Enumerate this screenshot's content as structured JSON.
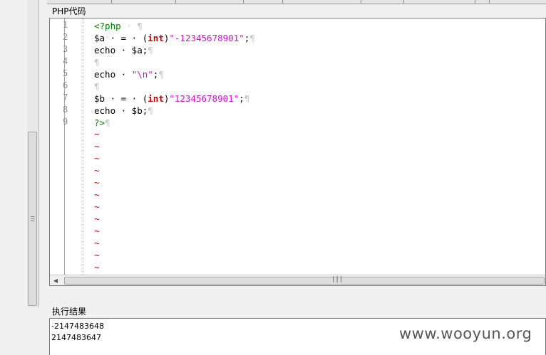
{
  "code_panel": {
    "title": "PHP代码",
    "lines": [
      {
        "no": "1",
        "parts": [
          {
            "t": "<?php",
            "c": "tag"
          },
          {
            "t": " · ",
            "c": "dot"
          },
          {
            "t": "¶",
            "c": "pil"
          }
        ]
      },
      {
        "no": "2",
        "parts": [
          {
            "t": "$a · = · (",
            "c": ""
          },
          {
            "t": "int",
            "c": "kw"
          },
          {
            "t": ")",
            "c": ""
          },
          {
            "t": "\"-12345678901\"",
            "c": "str"
          },
          {
            "t": ";",
            "c": ""
          },
          {
            "t": "¶",
            "c": "pil"
          }
        ]
      },
      {
        "no": "3",
        "parts": [
          {
            "t": "echo · $a;",
            "c": ""
          },
          {
            "t": "¶",
            "c": "pil"
          }
        ]
      },
      {
        "no": "4",
        "parts": [
          {
            "t": "¶",
            "c": "pil"
          }
        ]
      },
      {
        "no": "5",
        "parts": [
          {
            "t": "echo · ",
            "c": ""
          },
          {
            "t": "\"\\n\"",
            "c": "str"
          },
          {
            "t": ";",
            "c": ""
          },
          {
            "t": "¶",
            "c": "pil"
          }
        ]
      },
      {
        "no": "6",
        "parts": [
          {
            "t": "¶",
            "c": "pil"
          }
        ]
      },
      {
        "no": "7",
        "parts": [
          {
            "t": "$b · = · (",
            "c": ""
          },
          {
            "t": "int",
            "c": "kw"
          },
          {
            "t": ")",
            "c": ""
          },
          {
            "t": "\"12345678901\"",
            "c": "str"
          },
          {
            "t": ";",
            "c": ""
          },
          {
            "t": "¶",
            "c": "pil"
          }
        ]
      },
      {
        "no": "8",
        "parts": [
          {
            "t": "echo · $b;",
            "c": ""
          },
          {
            "t": "¶",
            "c": "pil"
          }
        ]
      },
      {
        "no": "9",
        "parts": [
          {
            "t": "?>",
            "c": "tag"
          },
          {
            "t": "¶",
            "c": "pil"
          }
        ]
      }
    ],
    "empty_marker": "~",
    "empty_count": 12
  },
  "result_panel": {
    "title": "执行结果",
    "lines": [
      "-2147483648",
      "2147483647"
    ]
  },
  "watermark": "www.wooyun.org",
  "icons": {
    "scroll_left": "arrow-left-icon",
    "grip": "grip-icon"
  },
  "colors": {
    "keyword": "#cc0000",
    "string": "#d010d0",
    "tag": "#008000",
    "tilde": "#d00000",
    "line_number": "#909090"
  }
}
